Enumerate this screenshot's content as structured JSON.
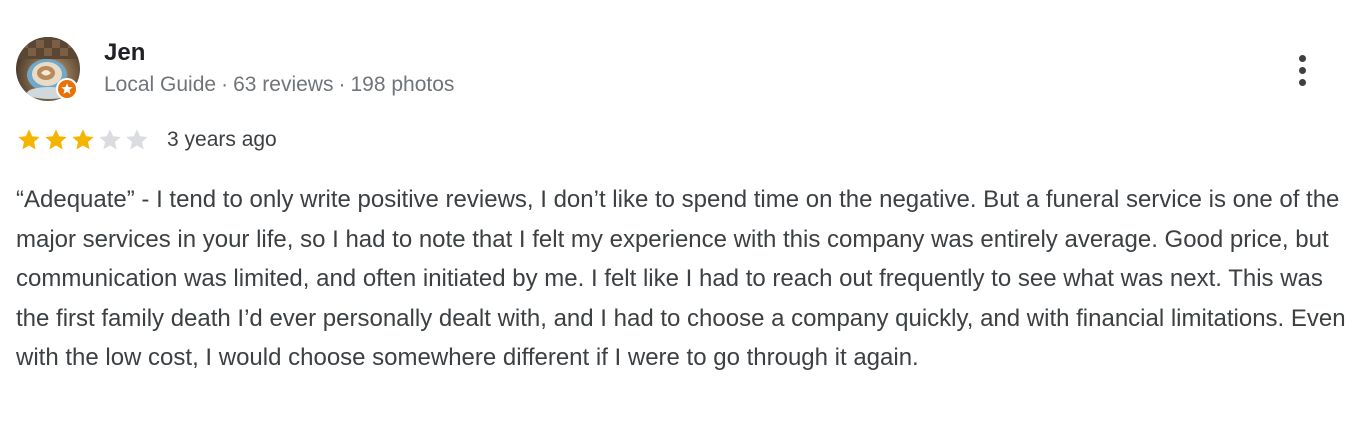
{
  "reviewer": {
    "name": "Jen",
    "role": "Local Guide",
    "reviews": "63 reviews",
    "photos": "198 photos",
    "separator": "·"
  },
  "avatar": {
    "icon": "coffee-latte-art-photo",
    "badge_icon": "local-guide-star-badge",
    "badge_color": "#e8710a"
  },
  "menu": {
    "icon": "more-vert-icon"
  },
  "rating": {
    "value": 3,
    "max": 5,
    "star_color": "#f4b400",
    "empty_star_color": "#dadce0"
  },
  "review": {
    "date": "3 years ago",
    "text": "“Adequate” - I tend to only write positive reviews, I don’t like to spend time on the negative. But a funeral service is one of the major services in your life, so I had to note that I felt my experience with this company was entirely average. Good price, but communication was limited, and often initiated by me. I felt like I had to reach out frequently to see what was next. This was the first family death I’d ever personally dealt with, and I had to choose a company quickly, and with financial limitations. Even with the low cost, I would choose somewhere different if I were to go through it again."
  }
}
